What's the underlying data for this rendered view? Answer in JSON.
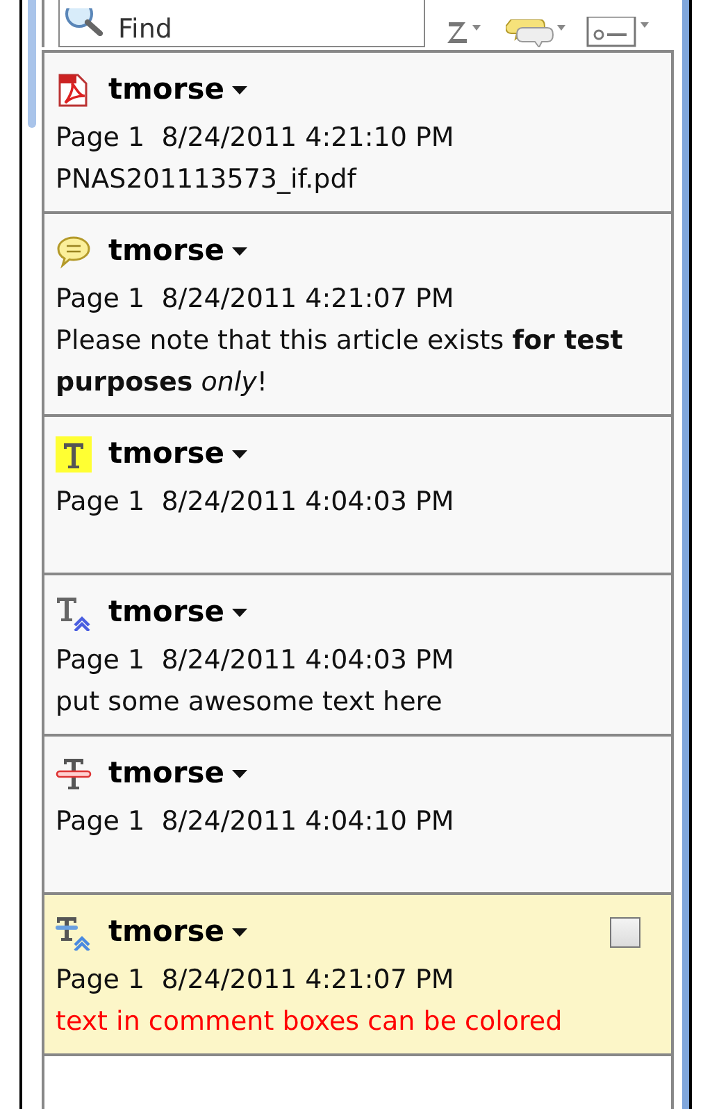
{
  "search": {
    "placeholder": "Find"
  },
  "toolbar": [
    {
      "kind": "sort"
    },
    {
      "kind": "comment"
    },
    {
      "kind": "options"
    }
  ],
  "comments": [
    {
      "kind": "file",
      "author": "tmorse",
      "meta": "Page 1  8/24/2011 4:21:10 PM",
      "body": "PNAS201113573_if.pdf",
      "selected": false
    },
    {
      "kind": "comment",
      "author": "tmorse",
      "meta": "Page 1  8/24/2011 4:21:07 PM",
      "body": "Please note that this article exists **for test purposes** *only*!",
      "selected": false
    },
    {
      "kind": "highlight",
      "author": "tmorse",
      "meta": "Page 1  8/24/2011 4:04:03 PM",
      "selected": false
    },
    {
      "kind": "insert",
      "author": "tmorse",
      "meta": "Page 1  8/24/2011 4:04:03 PM",
      "body": "put some awesome text here",
      "selected": false
    },
    {
      "kind": "strikethrough",
      "author": "tmorse",
      "meta": "Page 1  8/24/2011 4:04:10 PM",
      "selected": false
    },
    {
      "kind": "replace",
      "author": "tmorse",
      "meta": "Page 1  8/24/2011 4:21:07 PM",
      "body": "text in comment boxes can be colored",
      "color": "#ff0000",
      "selected": true,
      "checked": false
    }
  ]
}
